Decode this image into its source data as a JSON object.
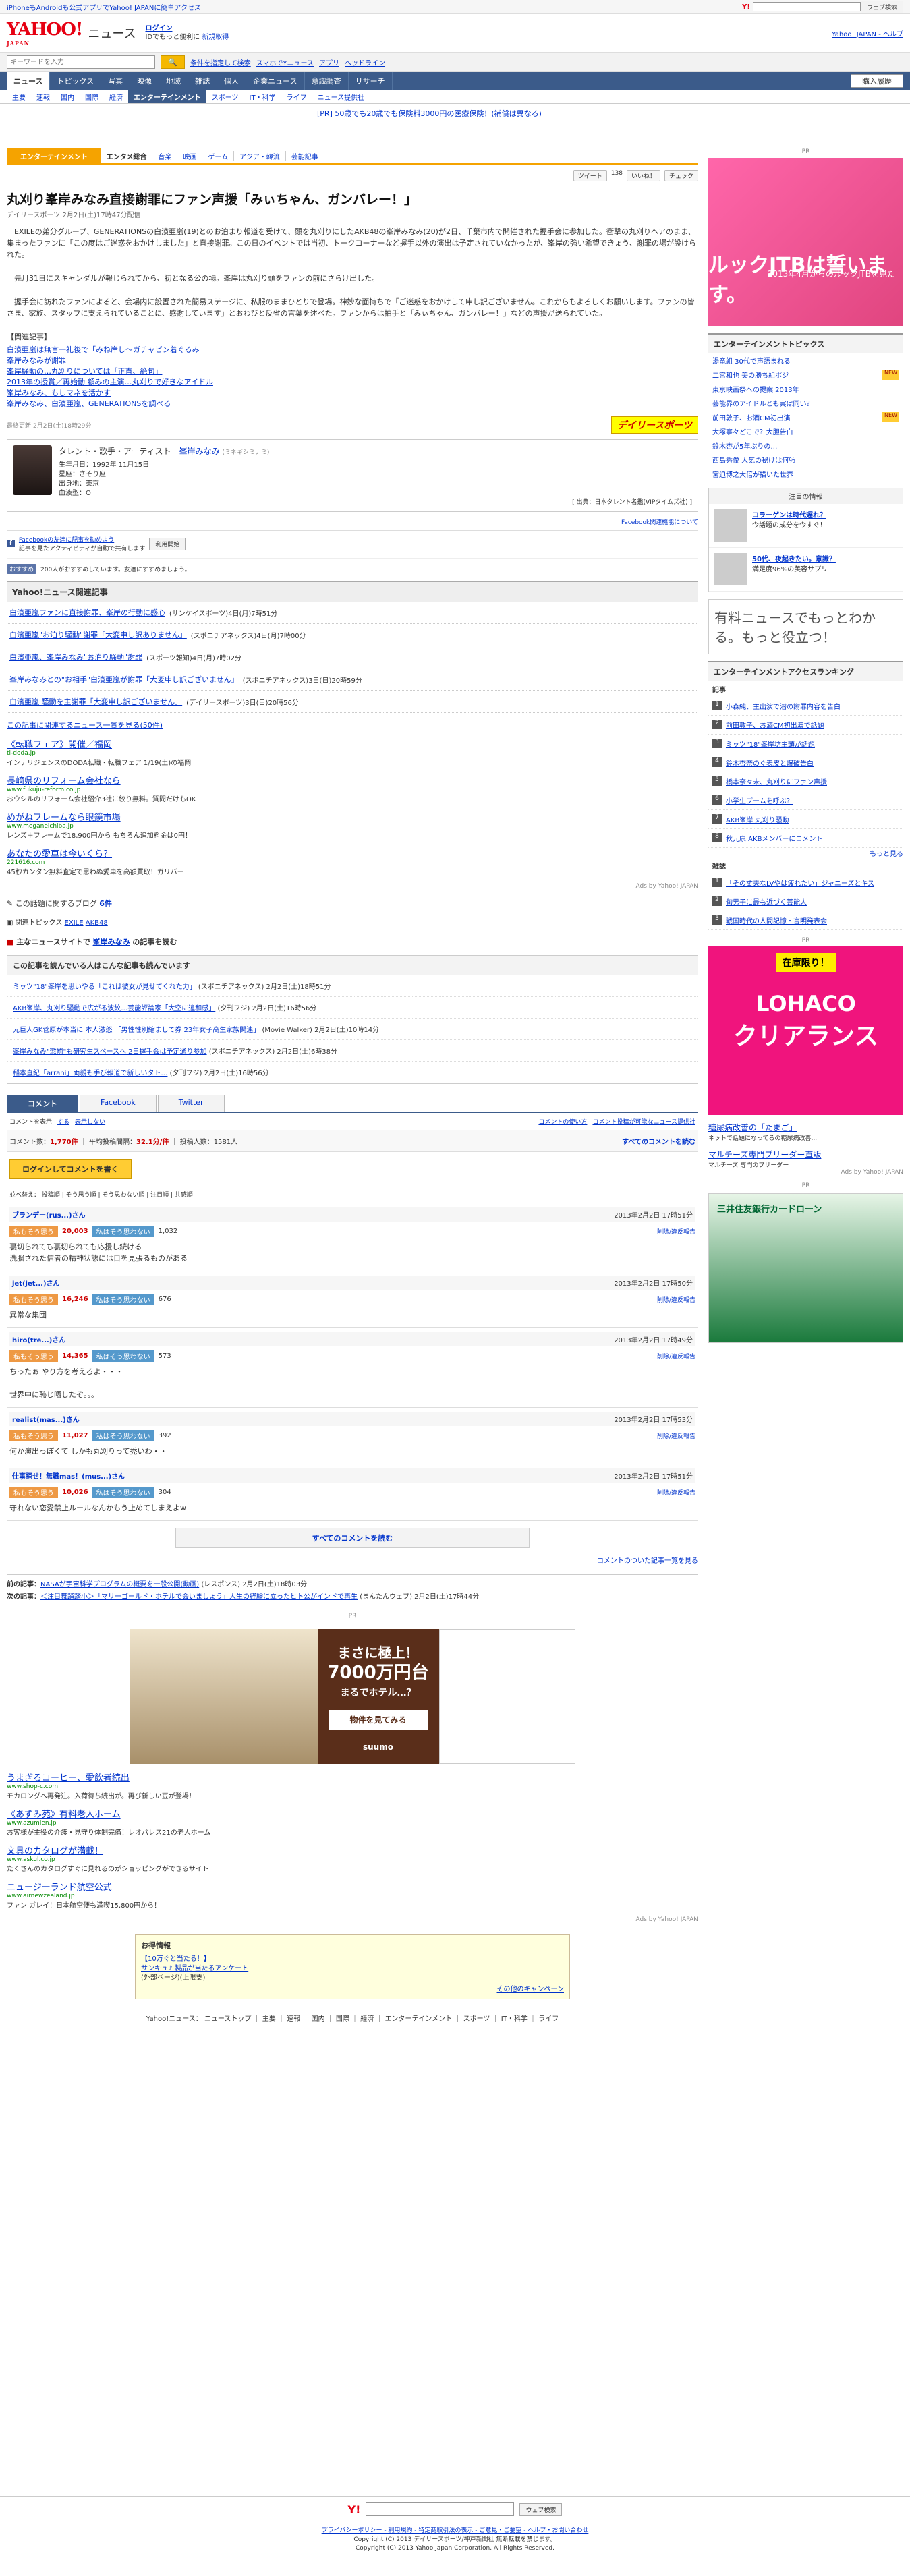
{
  "topbar": {
    "promo": "iPhoneもAndroidも公式アプリでYahoo! JAPANに簡単アクセス",
    "search_btn": "ウェブ検索"
  },
  "header": {
    "logo": "YAHOO!",
    "logo_sub": "JAPAN",
    "service": "ニュース",
    "login": "ログイン",
    "login_sub": "IDでもっと便利に",
    "register": "新規取得",
    "top_link": "Yahoo! JAPAN - ヘルプ"
  },
  "search": {
    "placeholder": "キーワードを入力",
    "options": [
      "条件を指定して検索",
      "スマホでYニュース",
      "アプリ",
      "ヘッドライン"
    ]
  },
  "nav": {
    "tabs": [
      "ニュース",
      "トピックス",
      "写真",
      "映像",
      "地域",
      "雑誌",
      "個人",
      "企業ニュース",
      "意識調査",
      "リサーチ"
    ],
    "buy": "購入履歴"
  },
  "subnav": [
    "主要",
    "速報",
    "国内",
    "国際",
    "経済",
    "エンターテインメント",
    "スポーツ",
    "IT・科学",
    "ライフ",
    "ニュース提供社"
  ],
  "adtext": "[PR] 50歳でも20歳でも保険料3000円の医療保険！(補償は異なる)",
  "category": {
    "label": "エンターテインメント",
    "items": [
      "エンタメ総合",
      "音楽",
      "映画",
      "ゲーム",
      "アジア・韓流",
      "芸能記事"
    ]
  },
  "share": {
    "tweet": "ツイート",
    "tweet_count": "138",
    "like": "いいね！",
    "mixi": "チェック"
  },
  "article": {
    "title": "丸刈り峯岸みなみ直接謝罪にファン声援「みぃちゃん、ガンバレー！」",
    "meta": "デイリースポーツ 2月2日(土)17時47分配信",
    "p1": "EXILEの弟分グループ、GENERATIONSの白濱亜嵐(19)とのお泊まり報道を受けて、頭を丸刈りにしたAKB48の峯岸みなみ(20)が2日、千葉市内で開催された握手会に参加した。衝撃の丸刈りヘアのまま、集まったファンに「この度はご迷惑をおかけしました」と直接謝罪。この日のイベントでは当初、トークコーナーなど握手以外の演出は予定されていなかったが、峯岸の強い希望できょう、謝罪の場が設けられた。",
    "p2": "先月31日にスキャンダルが報じられてから、初となる公の場。峯岸は丸刈り頭をファンの前にさらけ出した。",
    "p3": "握手会に訪れたファンによると、会場内に設置された簡易ステージに、私服のままひとりで登場。神妙な面持ちで「ご迷惑をおかけして申し訳ございません。これからもよろしくお願いします。ファンの皆さま、家族、スタッフに支えられていることに、感謝しています」とおわびと反省の言葉を述べた。ファンからは拍手と「みぃちゃん、ガンバレー！」などの声援が送られていた。",
    "related_head": "【関連記事】",
    "related": [
      "白濱亜嵐は無言一礼後で「みね岸し〜ガチャピン着ぐるみ",
      "峯岸みなみが謝罪",
      "峯岸騒動の…丸刈りについては「正直、絶句」",
      "2013年の授賞／再始動 顧みの主演…丸刈りで好きなアイドル",
      "峯岸みなみ、もしマネを活かす",
      "峯岸みなみ、白濱亜嵐、GENERATIONSを調べる"
    ],
    "modified": "最終更新:2月2日(土)18時29分",
    "source_logo": "デイリースポーツ"
  },
  "person": {
    "category": "タレント・歌手・アーティスト",
    "name": "峯岸みなみ",
    "kana": "(ミネギシミナミ)",
    "birth": "生年月日：1992年 11月15日",
    "sign": "星座：さそり座",
    "from": "出身地：東京",
    "blood": "血液型：O",
    "src": "[ 出典：日本タレント名鑑(VIPタイムズ社) ]"
  },
  "facebook": {
    "about": "Facebook関連機能について",
    "share_text": "Facebookの友達に記事を勧めよう",
    "share_sub": "記事を見たアクティビティが自動で共有します",
    "btn": "利用開始",
    "like_btn": "おすすめ",
    "like_text": "200人がおすすめしています。友達にすすめましょう。"
  },
  "related_news": {
    "title": "Yahoo!ニュース関連記事",
    "items": [
      {
        "t": "白濱亜嵐ファンに直接謝罪、峯岸の行動に感心",
        "s": "(サンケイスポーツ)4日(月)7時51分"
      },
      {
        "t": "白濱亜嵐\"お泊り騒動\"謝罪「大変申し訳ありません」",
        "s": "(スポニチアネックス)4日(月)7時00分"
      },
      {
        "t": "白濱亜嵐、峯岸みなみ\"お泊り騒動\"謝罪",
        "s": "(スポーツ報知)4日(月)7時02分"
      },
      {
        "t": "峯岸みなみとの\"お相手\"白濱亜嵐が謝罪「大変申し訳ございません」",
        "s": "(スポニチアネックス)3日(日)20時59分"
      },
      {
        "t": "白濱亜嵐 騒動を主謝罪「大変申し訳ございません」",
        "s": "(デイリースポーツ)3日(日)20時56分"
      }
    ],
    "all": "この記事に関連するニュース一覧を見る(50件)"
  },
  "sponsor": [
    {
      "t": "《転職フェア》開催／福岡",
      "u": "tl-doda.jp",
      "d": "インテリジェンスのDODA転職・転職フェア 1/19(土)の福岡"
    },
    {
      "t": "長崎県のリフォーム会社なら",
      "u": "www.fukuju-reform.co.jp",
      "d": "おウシルのリフォーム会社紹介3社に絞り無料。質問だけもOK"
    },
    {
      "t": "めがねフレームなら眼鏡市場",
      "u": "www.meganeichiba.jp",
      "d": "レンズ＋フレームで18,900円から もちろん追加料金は0円！"
    },
    {
      "t": "あなたの愛車は今いくら？",
      "u": "221616.com",
      "d": "45秒カンタン無料査定で思わぬ愛車を高額買取！ガリバー"
    }
  ],
  "ads_by": "Ads by Yahoo! JAPAN",
  "blog": {
    "label": "この話題に関するブログ",
    "count": "6件"
  },
  "topics": {
    "label": "関連トピックス",
    "items": [
      "EXILE",
      "AKB48"
    ]
  },
  "main_site": {
    "label": "主なニュースサイトで",
    "name": "峯岸みなみ",
    "rest": "の記事を読む"
  },
  "also_read": {
    "title": "この記事を読んでいる人はこんな記事も読んでいます",
    "items": [
      {
        "t": "ミッツ\"18\"峯岸を思いやる「これは彼女が見せてくれた力」",
        "s": "(スポニチアネックス) 2月2日(土)18時51分"
      },
      {
        "t": "AKB峯岸、丸刈り騒動で広がる波紋…芸能評論家「大空に違和感」",
        "s": "(夕刊フジ) 2月2日(土)16時56分"
      },
      {
        "t": "元巨人GK菅原が本当に 本人激怒 「男性性別縮まして券 23年女子高生家族関連」",
        "s": "(Movie Walker) 2月2日(土)10時14分"
      },
      {
        "t": "峯岸みなみ\"懲罰\"も研究生スペースへ 2日握手会は予定通り参加",
        "s": "(スポニチアネックス) 2月2日(土)6時38分"
      },
      {
        "t": "稲本直紀「arrani」両親も手び報道で新しいタト…",
        "s": "(夕刊フジ) 2月2日(土)16時56分"
      }
    ]
  },
  "comments": {
    "tabs": [
      "コメント",
      "Facebook",
      "Twitter"
    ],
    "show_label": "コメントを表示",
    "show": "する",
    "hide": "表示しない",
    "policy": "コメントの使い方",
    "guide": "コメント投稿が可能なニュース提供社",
    "count_label": "コメント数：",
    "count": "1,770件",
    "avg_label": "平均投稿間隔：",
    "avg": "32.1分/件",
    "posts_label": "投稿人数：",
    "posts": "1581人",
    "see_all": "すべてのコメントを読む",
    "login_btn": "ログインしてコメントを書く",
    "sort": "並べ替え： 投稿順 | そう思う順 | そう思わない順 | 注目順 | 共感順",
    "items": [
      {
        "u": "ブランデー(rus...)さん",
        "date": "2013年2月2日 17時51分",
        "yes": "20,003",
        "no": "1,032",
        "txt": "裏切られても裏切られても応援し続ける\n洗脳された信者の精神状態には目を見張るものがある"
      },
      {
        "u": "jet(jet...)さん",
        "date": "2013年2月2日 17時50分",
        "yes": "16,246",
        "no": "676",
        "txt": "異常な集団"
      },
      {
        "u": "hiro(tre...)さん",
        "date": "2013年2月2日 17時49分",
        "yes": "14,365",
        "no": "573",
        "txt": "ちったぁ やり方を考えろよ・・・\n\n世界中に恥じ晒したぞ。。。"
      },
      {
        "u": "realist(mas...)さん",
        "date": "2013年2月2日 17時53分",
        "yes": "11,027",
        "no": "392",
        "txt": "何か演出っぽくて しかも丸刈りって禿いわ・・"
      },
      {
        "u": "仕事探せ！無職mas！(mus...)さん",
        "date": "2013年2月2日 17時51分",
        "yes": "10,026",
        "no": "304",
        "txt": "守れない恋愛禁止ルールなんかもう止めてしまえよw"
      }
    ],
    "yes_label": "私もそう思う",
    "no_label": "私はそう思わない",
    "del": "削除/違反報告",
    "all_btn": "すべてのコメントを読む",
    "list_link": "コメントのついた記事一覧を見る"
  },
  "prevnext": {
    "prev_label": "前の記事：",
    "prev": "NASAが宇宙科学プログラムの概要を一般公開(動画)",
    "prev_s": "(レスポンス) 2月2日(土)18時03分",
    "next_label": "次の記事：",
    "next": "＜注目舞踊踏小＞「マリーゴールド・ホテルで会いましょう」人生の経験に立ったヒト公がインドで再生",
    "next_s": "(まんたんウェブ) 2月2日(土)17時44分"
  },
  "prad": {
    "line1": "まさに極上！",
    "line2": "7000万円台",
    "line3": "まるでホテル…？",
    "line4": "物件を見てみる",
    "brand": "suumo"
  },
  "bottom_sponsor": [
    {
      "t": "うまぎるコーヒー、愛飲者続出",
      "u": "www.shop-c.com",
      "d": "モカロングへ再発注。入荷待ち続出が。再び新しい豆が登場！"
    },
    {
      "t": "《あずみ苑》有料老人ホーム",
      "u": "www.azumien.jp",
      "d": "お客様が主役の介護・見守り体制完備！レオパレス21の老人ホーム"
    },
    {
      "t": "文具のカタログが満載！",
      "u": "www.askul.co.jp",
      "d": "たくさんのカタログすぐに見れるのがショッピングができるサイト"
    },
    {
      "t": "ニュージーランド航空公式",
      "u": "www.airnewzealand.jp",
      "d": "ファン ガレイ！日本航空便も満喫15,800円から！"
    }
  ],
  "info": {
    "title": "お得情報",
    "l1": "【10万ぐと当たる！】",
    "l2": "サンキュ♪ 製品が当たるアンケート",
    "l3": "(外部ページ)(上限支)",
    "more": "その他のキャンペーン"
  },
  "footer": {
    "services": "Yahoo!ニュース： ニューストップ ｜ 主要 ｜ 速報 ｜ 国内 ｜ 国際 ｜ 経済 ｜ エンターテインメント ｜ スポーツ ｜ IT・科学 ｜ ライフ",
    "search_btn": "ウェブ検索",
    "links": "プライバシーポリシー - 利用規約 - 特定商取引法の表示 - ご意見・ご要望 - ヘルプ・お問い合わせ",
    "copy1": "Copyright (C) 2013 デイリースポーツ/神戸新聞社 無断転載を禁じます。",
    "copy2": "Copyright (C) 2013 Yahoo Japan Corporation. All Rights Reserved."
  },
  "side": {
    "pr": "PR",
    "jtb_sm": "2013年4月からのルックJTBを見た",
    "jtb_big": "ルックJTBは誓います。",
    "topics_title": "エンターテインメントトピックス",
    "topics": [
      "湯竜組 30代で声語まれる",
      "二宮和也 美の勝ち組ポジ",
      "東京映画祭への提案 2013年",
      "芸能界のアイドルとも実は同い？",
      "前田敦子、お酒CM初出演",
      "大塚寧々どこで？大胆告白",
      "鈴木杏が5年ぶりの…",
      "西島秀俊 人気の秘けは何％",
      "宮迫博之大倍が描いた世界"
    ],
    "attn_title": "注目の情報",
    "attn": [
      {
        "t": "コラーゲンは時代遅れ？",
        "d": "今話題の成分を今すぐ！"
      },
      {
        "t": "50代、夜起きたい。意識？",
        "d": "満足度96%の美容サプリ"
      }
    ],
    "banner": "有料ニュースでもっとわかる。もっと役立つ！",
    "ranking_title": "エンターテインメントアクセスランキング",
    "ranking_sub": "記事",
    "ranking": [
      "小森純、主出演で潜の謝罪内容を告白",
      "前田敦子、お酒CM初出演で話題",
      "ミッツ\"18\"峯岸坊主頭が話題",
      "鈴木杏奈のぐ表皮と爆破告白",
      "橋本奈々未、丸刈りにファン声援",
      "小学生ブームを呼ぶ？",
      "AKB峯岸 丸刈り騒動",
      "秋元康 AKBメンバーにコメント"
    ],
    "magazine_sub": "雑誌",
    "magazines": [
      "「その丈夫なLVやは疲れたい」ジャニーズとキス",
      "旬男子に最も近づく芸能人",
      "戦国時代の人間記憶・言明発表会"
    ],
    "more": "もっと見る",
    "lohaco_hdr": "在庫限り！",
    "lohaco_logo": "LOHACO",
    "lohaco_big": "クリアランス",
    "side_sponsor": [
      {
        "t": "糖尿病改善の「たまご」",
        "d": "ネットで話題になってるの糖尿病改善..."
      },
      {
        "t": "マルチーズ専門ブリーダー直販",
        "d": "マルチーズ 専門のブリーダー"
      }
    ],
    "smbc": "三井住友銀行カードローン"
  }
}
